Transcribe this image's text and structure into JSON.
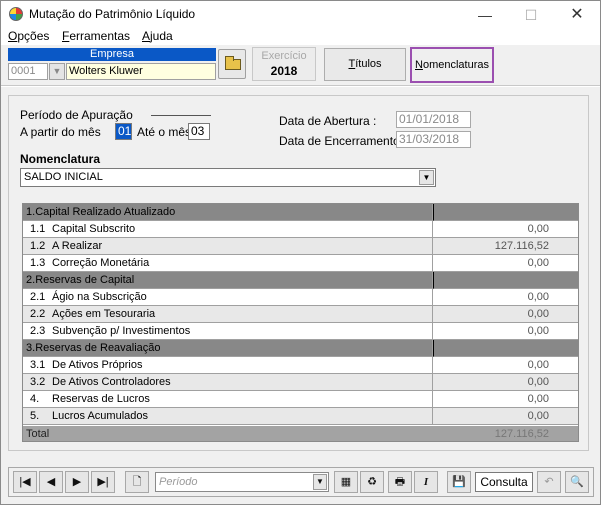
{
  "window": {
    "title": "Mutação do Patrimônio Líquido",
    "min_glyph": "—",
    "max_glyph": "☐",
    "close_glyph": "✕"
  },
  "menu": {
    "items": [
      {
        "first": "O",
        "rest": "pções"
      },
      {
        "first": "F",
        "rest": "erramentas"
      },
      {
        "first": "A",
        "rest": "juda"
      }
    ]
  },
  "header": {
    "empresa_label": "Empresa",
    "empresa_code": "0001",
    "empresa_name": "Wolters Kluwer",
    "exercicio_label": "Exercício",
    "exercicio_value": "2018",
    "titulos_first": "T",
    "titulos_rest": "ítulos",
    "nomenclaturas_first": "N",
    "nomenclaturas_rest": "omenclaturas"
  },
  "form": {
    "periodo_label": "Período de Apuração",
    "a_partir_label": "A partir do mês",
    "a_partir_value": "01",
    "ate_label": "Até o mês",
    "ate_value": "03",
    "abertura_label": "Data de Abertura :",
    "abertura_value": "01/01/2018",
    "encerramento_label": "Data de Encerramento :",
    "encerramento_value": "31/03/2018",
    "nomenclatura_label": "Nomenclatura",
    "nomenclatura_value": "SALDO INICIAL"
  },
  "grid": {
    "rows": [
      {
        "type": "group",
        "code": "1.",
        "label": "Capital Realizado Atualizado",
        "value": ""
      },
      {
        "type": "item",
        "code": "1.1",
        "label": "Capital Subscrito",
        "value": "0,00"
      },
      {
        "type": "item",
        "code": "1.2",
        "label": "A Realizar",
        "value": "127.116,52"
      },
      {
        "type": "item",
        "code": "1.3",
        "label": "Correção Monetária",
        "value": "0,00"
      },
      {
        "type": "group",
        "code": "2.",
        "label": "Reservas de Capital",
        "value": ""
      },
      {
        "type": "item",
        "code": "2.1",
        "label": "Ágio na Subscrição",
        "value": "0,00"
      },
      {
        "type": "item",
        "code": "2.2",
        "label": "Ações em Tesouraria",
        "value": "0,00"
      },
      {
        "type": "item",
        "code": "2.3",
        "label": "Subvenção p/ Investimentos",
        "value": "0,00"
      },
      {
        "type": "group",
        "code": "3.",
        "label": "Reservas de Reavaliação",
        "value": ""
      },
      {
        "type": "item",
        "code": "3.1",
        "label": "De Ativos Próprios",
        "value": "0,00"
      },
      {
        "type": "item",
        "code": "3.2",
        "label": "De Ativos Controladores",
        "value": "0,00"
      },
      {
        "type": "item",
        "code": "4.",
        "label": "Reservas de Lucros",
        "value": "0,00"
      },
      {
        "type": "item",
        "code": "5.",
        "label": "Lucros Acumulados",
        "value": "0,00"
      }
    ],
    "total_label": "Total",
    "total_value": "127.116,52"
  },
  "toolbar": {
    "periodo_placeholder": "Período",
    "status_text": "Consulta",
    "first_glyph": "|◀",
    "prev_glyph": "◀",
    "next_glyph": "▶",
    "last_glyph": "▶|",
    "new_glyph": "🗋",
    "print_glyph": "🖶",
    "italic_glyph": "I",
    "save_glyph": "💾",
    "undo_glyph": "↶",
    "find_glyph": "🔍"
  }
}
